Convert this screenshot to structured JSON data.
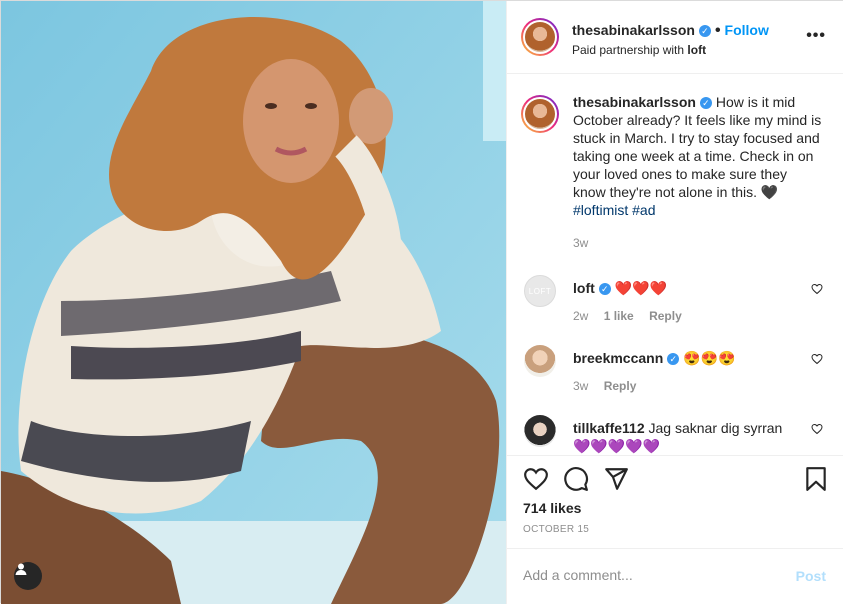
{
  "post": {
    "author": "thesabinakarlsson",
    "follow_label": "Follow",
    "partner_prefix": "Paid partnership with ",
    "partner_name": "loft",
    "more_label": "•••",
    "caption": {
      "author": "thesabinakarlsson",
      "text": "How is it mid October already? It feels like my mind is stuck in March. I try to stay focused and taking one week at a time. Check in on your loved ones to make sure they know they're not alone in this. 🖤",
      "hashtags": "#loftimist #ad",
      "time": "3w"
    },
    "comments": [
      {
        "user": "loft",
        "verified": true,
        "text": "❤️❤️❤️",
        "time": "2w",
        "likes": "1 like",
        "reply": "Reply",
        "avatar_label": "LOFT"
      },
      {
        "user": "breekmccann",
        "verified": true,
        "text": "😍😍😍",
        "time": "3w",
        "likes": "",
        "reply": "Reply"
      },
      {
        "user": "tillkaffe112",
        "verified": false,
        "text": "Jag saknar dig syrran 💜💜💜💜💜",
        "time": "",
        "likes": "",
        "reply": ""
      }
    ],
    "likes": "714 likes",
    "date": "OCTOBER 15",
    "add_comment_placeholder": "Add a comment...",
    "post_label": "Post"
  },
  "colors": {
    "accent": "#0095f6",
    "verified": "#3897f0",
    "hashtag": "#00376b",
    "muted": "#8e8e8e",
    "post_disabled": "#b2dffc",
    "photo_bg": "#8fd0e6"
  },
  "icons": [
    "verified-badge-icon",
    "more-options-icon",
    "heart-icon",
    "comment-icon",
    "share-icon",
    "save-icon",
    "user-tag-icon"
  ]
}
